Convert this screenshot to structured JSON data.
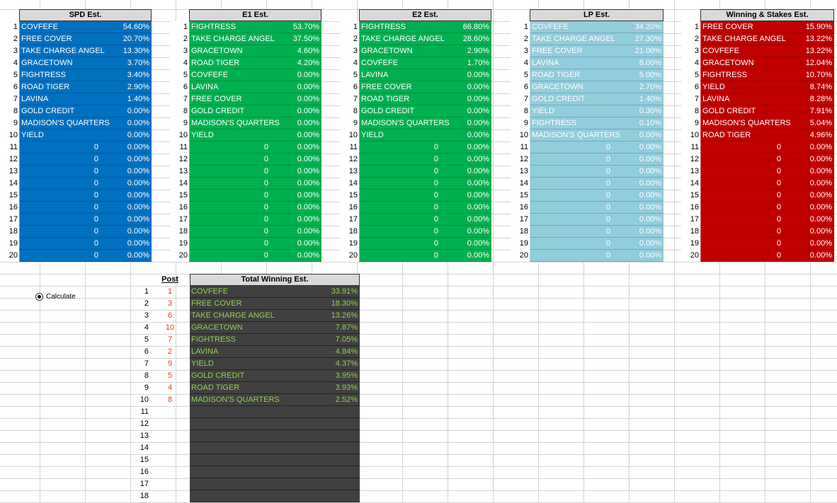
{
  "calculate_label": "Calculate",
  "blocks": [
    {
      "id": "spd",
      "title": "SPD Est.",
      "rows": [
        {
          "n": "1",
          "name": "COVFEFE",
          "pct": "54.60%"
        },
        {
          "n": "2",
          "name": "FREE COVER",
          "pct": "20.70%"
        },
        {
          "n": "3",
          "name": "TAKE CHARGE ANGEL",
          "pct": "13.30%"
        },
        {
          "n": "4",
          "name": "GRACETOWN",
          "pct": "3.70%"
        },
        {
          "n": "5",
          "name": "FIGHTRESS",
          "pct": "3.40%"
        },
        {
          "n": "6",
          "name": "ROAD TIGER",
          "pct": "2.90%"
        },
        {
          "n": "7",
          "name": "LAVINA",
          "pct": "1.40%"
        },
        {
          "n": "8",
          "name": "GOLD CREDIT",
          "pct": "0.00%"
        },
        {
          "n": "9",
          "name": "MADISON'S QUARTERS",
          "pct": "0.00%"
        },
        {
          "n": "10",
          "name": "YIELD",
          "pct": "0.00%"
        },
        {
          "n": "11",
          "zero": "0",
          "pct": "0.00%"
        },
        {
          "n": "12",
          "zero": "0",
          "pct": "0.00%"
        },
        {
          "n": "13",
          "zero": "0",
          "pct": "0.00%"
        },
        {
          "n": "14",
          "zero": "0",
          "pct": "0.00%"
        },
        {
          "n": "15",
          "zero": "0",
          "pct": "0.00%"
        },
        {
          "n": "16",
          "zero": "0",
          "pct": "0.00%"
        },
        {
          "n": "17",
          "zero": "0",
          "pct": "0.00%"
        },
        {
          "n": "18",
          "zero": "0",
          "pct": "0.00%"
        },
        {
          "n": "19",
          "zero": "0",
          "pct": "0.00%"
        },
        {
          "n": "20",
          "zero": "0",
          "pct": "0.00%"
        }
      ]
    },
    {
      "id": "e1",
      "title": "E1 Est.",
      "rows": [
        {
          "n": "1",
          "name": "FIGHTRESS",
          "pct": "53.70%"
        },
        {
          "n": "2",
          "name": "TAKE CHARGE ANGEL",
          "pct": "37.50%"
        },
        {
          "n": "3",
          "name": "GRACETOWN",
          "pct": "4.60%"
        },
        {
          "n": "4",
          "name": "ROAD TIGER",
          "pct": "4.20%"
        },
        {
          "n": "5",
          "name": "COVFEFE",
          "pct": "0.00%"
        },
        {
          "n": "6",
          "name": "LAVINA",
          "pct": "0.00%"
        },
        {
          "n": "7",
          "name": "FREE COVER",
          "pct": "0.00%"
        },
        {
          "n": "8",
          "name": "GOLD CREDIT",
          "pct": "0.00%"
        },
        {
          "n": "9",
          "name": "MADISON'S QUARTERS",
          "pct": "0.00%"
        },
        {
          "n": "10",
          "name": "YIELD",
          "pct": "0.00%"
        },
        {
          "n": "11",
          "zero": "0",
          "pct": "0.00%"
        },
        {
          "n": "12",
          "zero": "0",
          "pct": "0.00%"
        },
        {
          "n": "13",
          "zero": "0",
          "pct": "0.00%"
        },
        {
          "n": "14",
          "zero": "0",
          "pct": "0.00%"
        },
        {
          "n": "15",
          "zero": "0",
          "pct": "0.00%"
        },
        {
          "n": "16",
          "zero": "0",
          "pct": "0.00%"
        },
        {
          "n": "17",
          "zero": "0",
          "pct": "0.00%"
        },
        {
          "n": "18",
          "zero": "0",
          "pct": "0.00%"
        },
        {
          "n": "19",
          "zero": "0",
          "pct": "0.00%"
        },
        {
          "n": "20",
          "zero": "0",
          "pct": "0.00%"
        }
      ]
    },
    {
      "id": "e2",
      "title": "E2 Est.",
      "rows": [
        {
          "n": "1",
          "name": "FIGHTRESS",
          "pct": "66.80%"
        },
        {
          "n": "2",
          "name": "TAKE CHARGE ANGEL",
          "pct": "28.60%"
        },
        {
          "n": "3",
          "name": "GRACETOWN",
          "pct": "2.90%"
        },
        {
          "n": "4",
          "name": "COVFEFE",
          "pct": "1.70%"
        },
        {
          "n": "5",
          "name": "LAVINA",
          "pct": "0.00%"
        },
        {
          "n": "6",
          "name": "FREE COVER",
          "pct": "0.00%"
        },
        {
          "n": "7",
          "name": "ROAD TIGER",
          "pct": "0.00%"
        },
        {
          "n": "8",
          "name": "GOLD CREDIT",
          "pct": "0.00%"
        },
        {
          "n": "9",
          "name": "MADISON'S QUARTERS",
          "pct": "0.00%"
        },
        {
          "n": "10",
          "name": "YIELD",
          "pct": "0.00%"
        },
        {
          "n": "11",
          "zero": "0",
          "pct": "0.00%"
        },
        {
          "n": "12",
          "zero": "0",
          "pct": "0.00%"
        },
        {
          "n": "13",
          "zero": "0",
          "pct": "0.00%"
        },
        {
          "n": "14",
          "zero": "0",
          "pct": "0.00%"
        },
        {
          "n": "15",
          "zero": "0",
          "pct": "0.00%"
        },
        {
          "n": "16",
          "zero": "0",
          "pct": "0.00%"
        },
        {
          "n": "17",
          "zero": "0",
          "pct": "0.00%"
        },
        {
          "n": "18",
          "zero": "0",
          "pct": "0.00%"
        },
        {
          "n": "19",
          "zero": "0",
          "pct": "0.00%"
        },
        {
          "n": "20",
          "zero": "0",
          "pct": "0.00%"
        }
      ]
    },
    {
      "id": "lp",
      "title": "LP Est.",
      "rows": [
        {
          "n": "1",
          "name": "COVFEFE",
          "pct": "34.20%"
        },
        {
          "n": "2",
          "name": "TAKE CHARGE ANGEL",
          "pct": "27.30%"
        },
        {
          "n": "3",
          "name": "FREE COVER",
          "pct": "21.00%"
        },
        {
          "n": "4",
          "name": "LAVINA",
          "pct": "8.00%"
        },
        {
          "n": "5",
          "name": "ROAD TIGER",
          "pct": "5.00%"
        },
        {
          "n": "6",
          "name": "GRACETOWN",
          "pct": "2.70%"
        },
        {
          "n": "7",
          "name": "GOLD CREDIT",
          "pct": "1.40%"
        },
        {
          "n": "8",
          "name": "YIELD",
          "pct": "0.30%"
        },
        {
          "n": "9",
          "name": "FIGHTRESS",
          "pct": "0.10%"
        },
        {
          "n": "10",
          "name": "MADISON'S QUARTERS",
          "pct": "0.00%"
        },
        {
          "n": "11",
          "zero": "0",
          "pct": "0.00%"
        },
        {
          "n": "12",
          "zero": "0",
          "pct": "0.00%"
        },
        {
          "n": "13",
          "zero": "0",
          "pct": "0.00%"
        },
        {
          "n": "14",
          "zero": "0",
          "pct": "0.00%"
        },
        {
          "n": "15",
          "zero": "0",
          "pct": "0.00%"
        },
        {
          "n": "16",
          "zero": "0",
          "pct": "0.00%"
        },
        {
          "n": "17",
          "zero": "0",
          "pct": "0.00%"
        },
        {
          "n": "18",
          "zero": "0",
          "pct": "0.00%"
        },
        {
          "n": "19",
          "zero": "0",
          "pct": "0.00%"
        },
        {
          "n": "20",
          "zero": "0",
          "pct": "0.00%"
        }
      ]
    },
    {
      "id": "win",
      "title": "Winning & Stakes Est.",
      "rows": [
        {
          "n": "1",
          "name": "FREE COVER",
          "pct": "15.90%"
        },
        {
          "n": "2",
          "name": "TAKE CHARGE ANGEL",
          "pct": "13.22%"
        },
        {
          "n": "3",
          "name": "COVFEFE",
          "pct": "13.22%"
        },
        {
          "n": "4",
          "name": "GRACETOWN",
          "pct": "12.04%"
        },
        {
          "n": "5",
          "name": "FIGHTRESS",
          "pct": "10.70%"
        },
        {
          "n": "6",
          "name": "YIELD",
          "pct": "8.74%"
        },
        {
          "n": "7",
          "name": "LAVINA",
          "pct": "8.28%"
        },
        {
          "n": "8",
          "name": "GOLD CREDIT",
          "pct": "7.91%"
        },
        {
          "n": "9",
          "name": "MADISON'S QUARTERS",
          "pct": "5.04%"
        },
        {
          "n": "10",
          "name": "ROAD TIGER",
          "pct": "4.96%"
        },
        {
          "n": "11",
          "zero": "0",
          "pct": "0.00%"
        },
        {
          "n": "12",
          "zero": "0",
          "pct": "0.00%"
        },
        {
          "n": "13",
          "zero": "0",
          "pct": "0.00%"
        },
        {
          "n": "14",
          "zero": "0",
          "pct": "0.00%"
        },
        {
          "n": "15",
          "zero": "0",
          "pct": "0.00%"
        },
        {
          "n": "16",
          "zero": "0",
          "pct": "0.00%"
        },
        {
          "n": "17",
          "zero": "0",
          "pct": "0.00%"
        },
        {
          "n": "18",
          "zero": "0",
          "pct": "0.00%"
        },
        {
          "n": "19",
          "zero": "0",
          "pct": "0.00%"
        },
        {
          "n": "20",
          "zero": "0",
          "pct": "0.00%"
        }
      ]
    }
  ],
  "total": {
    "post_header": "Post",
    "title": "Total Winning Est.",
    "rows": [
      {
        "idx": "1",
        "post": "1",
        "name": "COVFEFE",
        "pct": "33.91%"
      },
      {
        "idx": "2",
        "post": "3",
        "name": "FREE COVER",
        "pct": "18.30%"
      },
      {
        "idx": "3",
        "post": "6",
        "name": "TAKE CHARGE ANGEL",
        "pct": "13.26%"
      },
      {
        "idx": "4",
        "post": "10",
        "name": "GRACETOWN",
        "pct": "7.87%"
      },
      {
        "idx": "5",
        "post": "7",
        "name": "FIGHTRESS",
        "pct": "7.05%"
      },
      {
        "idx": "6",
        "post": "2",
        "name": "LAVINA",
        "pct": "4.84%"
      },
      {
        "idx": "7",
        "post": "9",
        "name": "YIELD",
        "pct": "4.37%"
      },
      {
        "idx": "8",
        "post": "5",
        "name": "GOLD CREDIT",
        "pct": "3.95%"
      },
      {
        "idx": "9",
        "post": "4",
        "name": "ROAD TIGER",
        "pct": "3.93%"
      },
      {
        "idx": "10",
        "post": "8",
        "name": "MADISON'S QUARTERS",
        "pct": "2.52%"
      },
      {
        "idx": "11"
      },
      {
        "idx": "12"
      },
      {
        "idx": "13"
      },
      {
        "idx": "14"
      },
      {
        "idx": "15"
      },
      {
        "idx": "16"
      },
      {
        "idx": "17"
      },
      {
        "idx": "18"
      }
    ]
  }
}
